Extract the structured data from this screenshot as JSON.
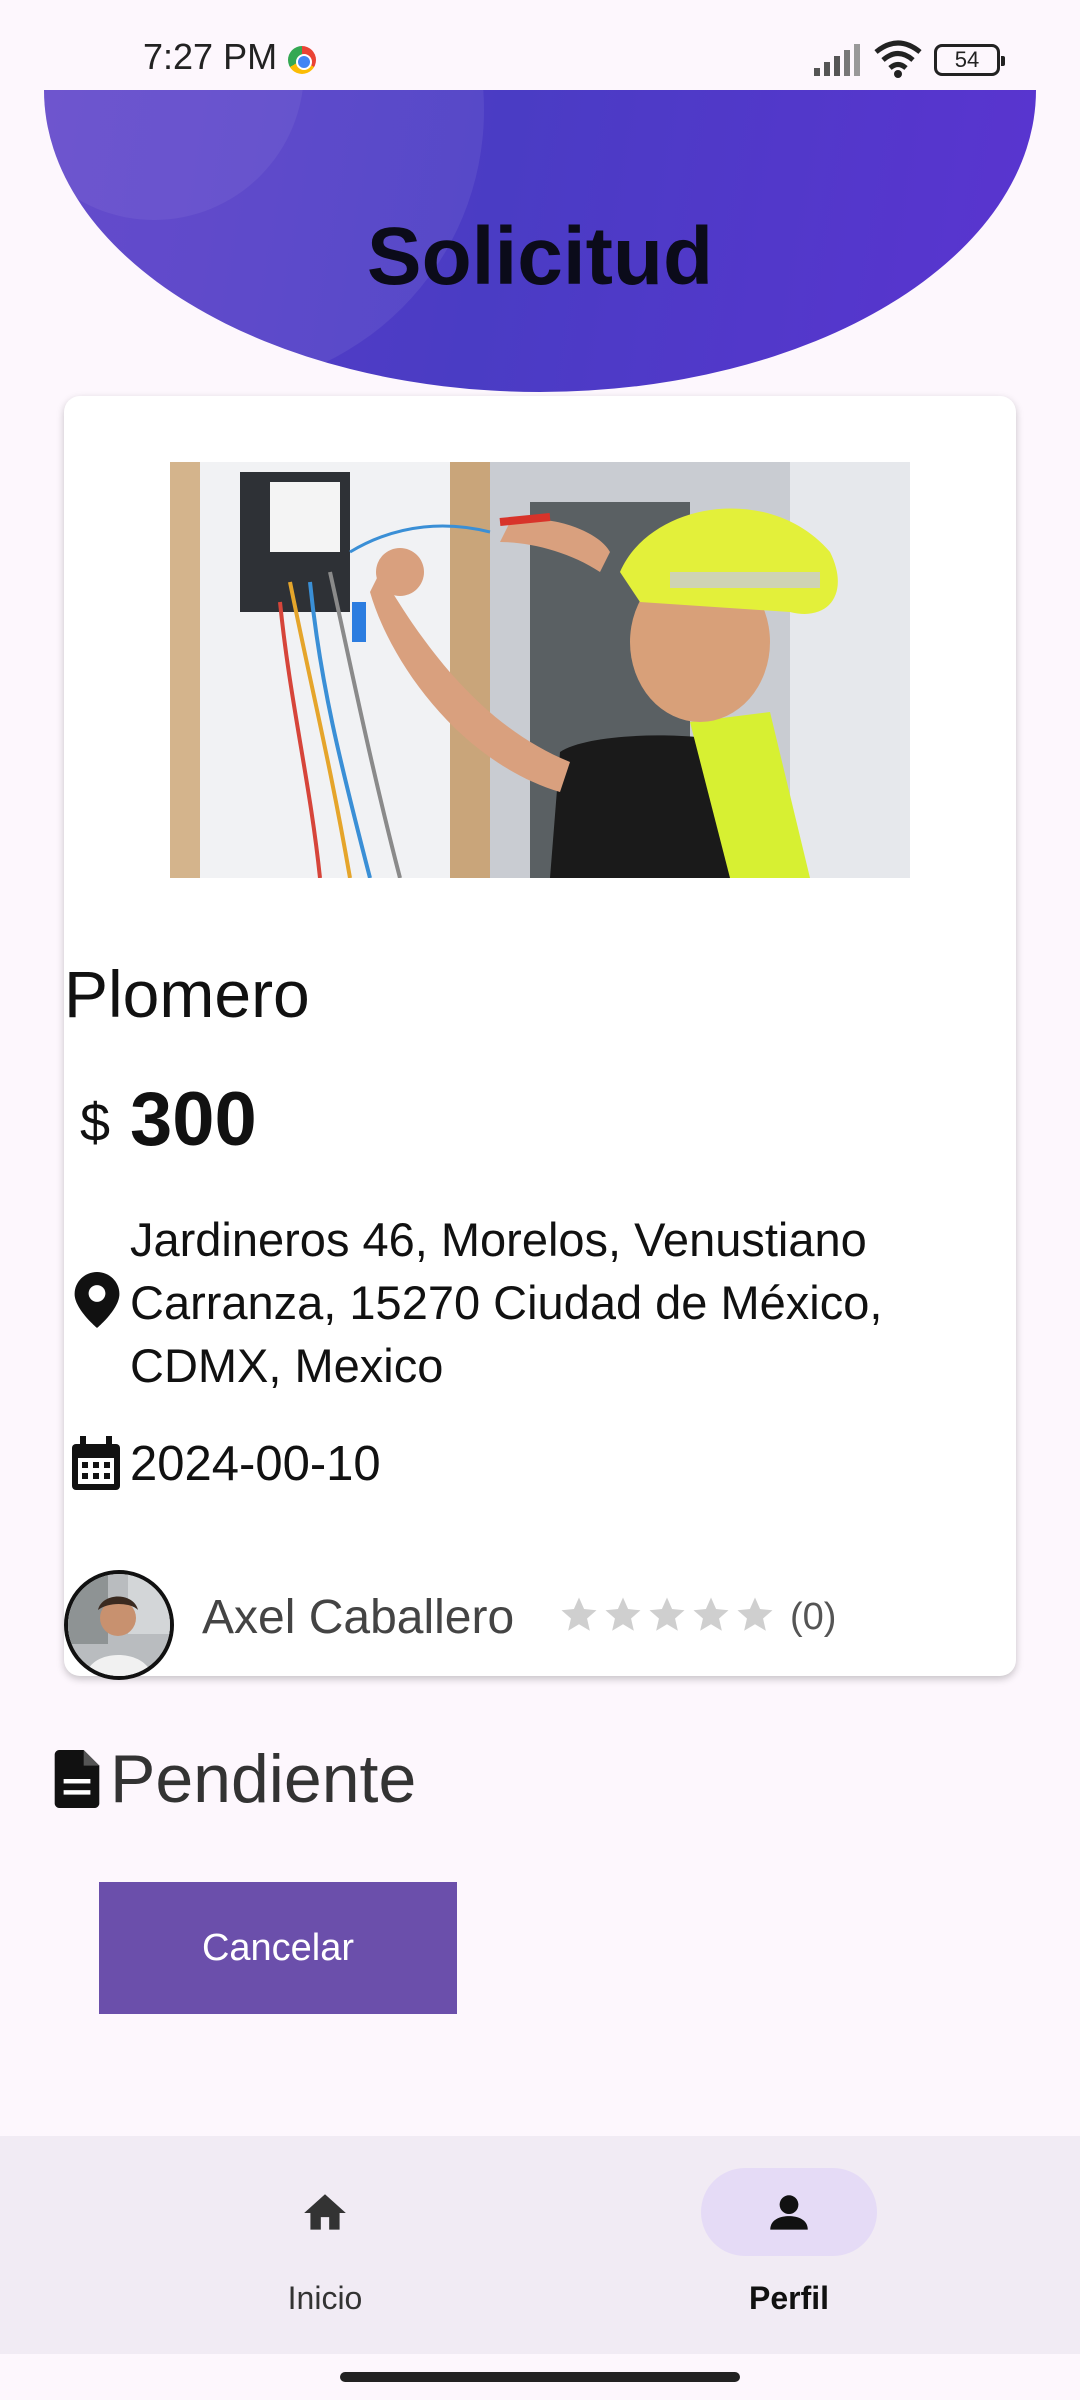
{
  "status_bar": {
    "time": "7:27 PM",
    "battery": "54"
  },
  "header": {
    "title": "Solicitud"
  },
  "request": {
    "service": "Plomero",
    "currency_symbol": "$",
    "price": "300",
    "address": "Jardineros 46, Morelos, Venustiano Carranza, 15270 Ciudad de México, CDMX, Mexico",
    "date": "2024-00-10",
    "owner": {
      "name": "Axel Caballero",
      "rating": 0,
      "rating_max": 5,
      "rating_count": "(0)"
    },
    "status": "Pendiente"
  },
  "actions": {
    "cancel_label": "Cancelar"
  },
  "bottom_nav": {
    "items": [
      {
        "label": "Inicio",
        "icon": "home-icon",
        "active": false
      },
      {
        "label": "Perfil",
        "icon": "person-icon",
        "active": true
      }
    ]
  },
  "colors": {
    "header_gradient_start": "#5a3ec8",
    "header_gradient_end": "#5a34d0",
    "button": "#6b4fab",
    "nav_active_pill": "#e5dbf6",
    "background": "#fdf7fd"
  }
}
